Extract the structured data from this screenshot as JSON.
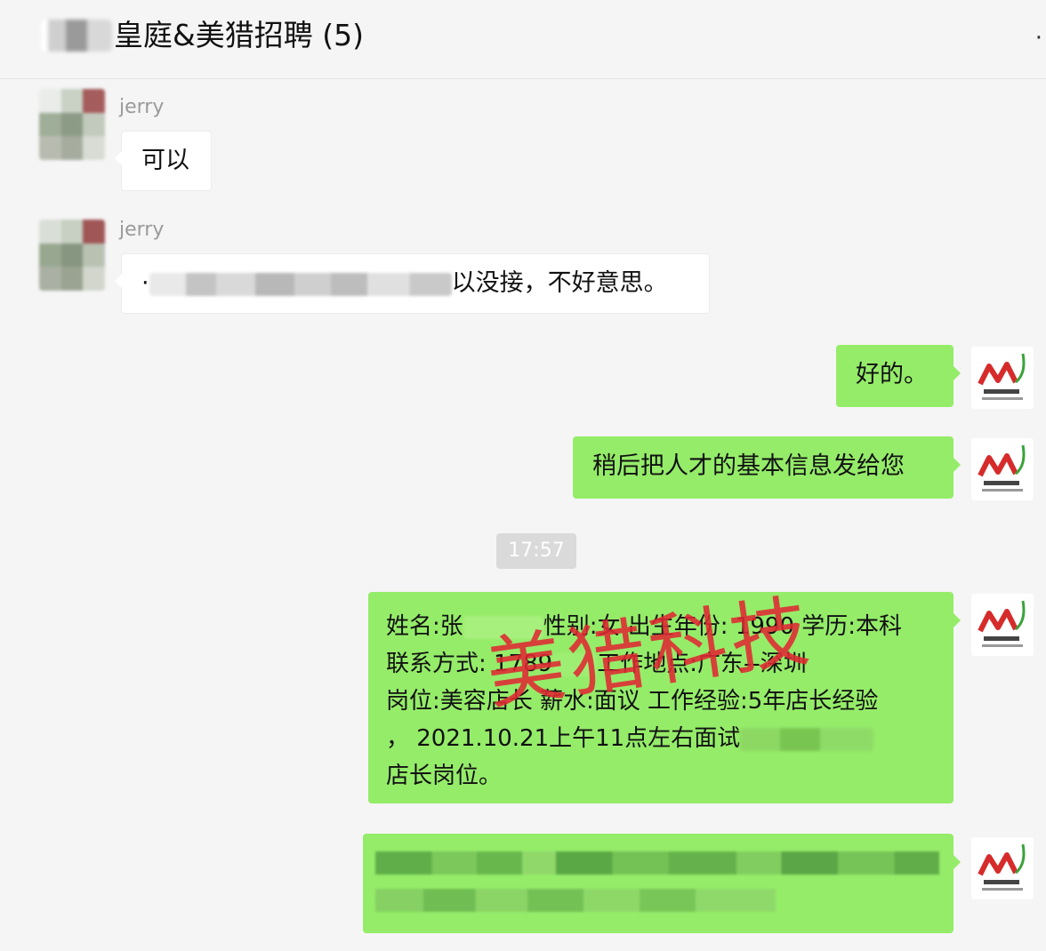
{
  "header": {
    "title": "皇庭&美猎招聘 (5)",
    "more_icon": "more-icon"
  },
  "messages": [
    {
      "side": "left",
      "sender": "jerry",
      "text": "可以"
    },
    {
      "side": "left",
      "sender": "jerry",
      "text_prefix": "·",
      "text": "以没接，不好意思。"
    },
    {
      "side": "right",
      "text": "好的。"
    },
    {
      "side": "right",
      "text": "稍后把人才的基本信息发给您"
    },
    {
      "side": "right",
      "lines": [
        "姓名:张",
        "性别:女 出生年份: 1990 学历:本科",
        "联系方式: 1789",
        "工作地点:广东--深圳",
        "岗位:美容店长 薪水:面议 工作经验:5年店长经验",
        "， 2021.10.21上午11点左右面试",
        "店长岗位。"
      ]
    }
  ],
  "timestamp": "17:57",
  "watermark": "美猎科技",
  "colors": {
    "green_bubble": "#95ec69",
    "white_bubble": "#ffffff",
    "background": "#f5f5f5",
    "watermark": "#e02832"
  }
}
